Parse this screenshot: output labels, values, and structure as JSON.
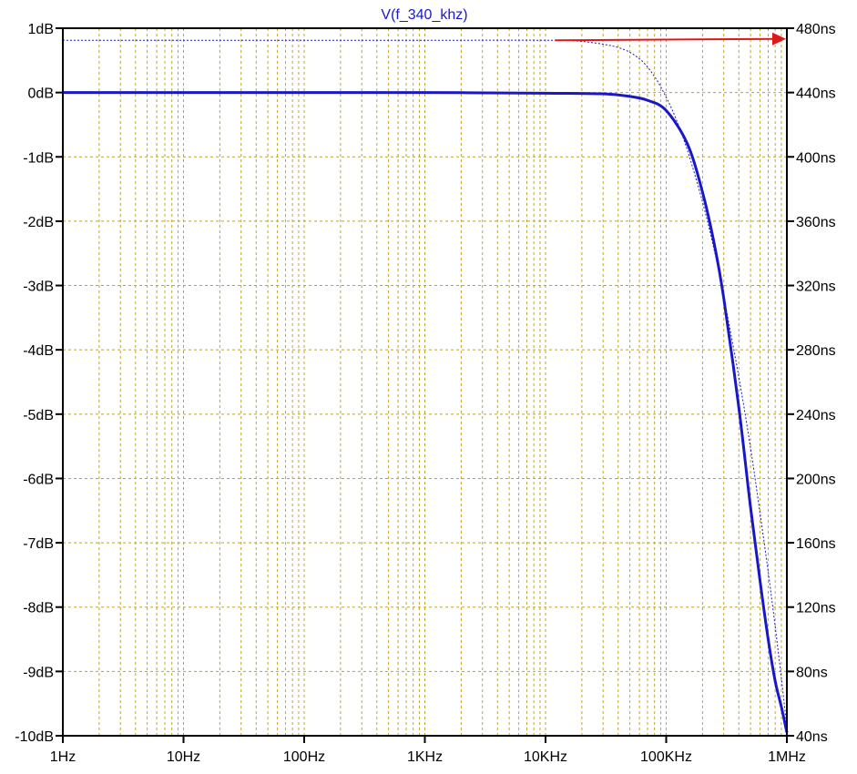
{
  "chart_data": {
    "type": "line",
    "title": "V(f_340_khz)",
    "x_scale": "log",
    "xlim": [
      1,
      1000000
    ],
    "x_ticks": [
      {
        "value": 1,
        "label": "1Hz"
      },
      {
        "value": 10,
        "label": "10Hz"
      },
      {
        "value": 100,
        "label": "100Hz"
      },
      {
        "value": 1000,
        "label": "1KHz"
      },
      {
        "value": 10000,
        "label": "10KHz"
      },
      {
        "value": 100000,
        "label": "100KHz"
      },
      {
        "value": 1000000,
        "label": "1MHz"
      }
    ],
    "y_left": {
      "unit": "dB",
      "ylim": [
        -10,
        1
      ],
      "ticks": [
        {
          "value": 1,
          "label": "1dB"
        },
        {
          "value": 0,
          "label": "0dB"
        },
        {
          "value": -1,
          "label": "-1dB"
        },
        {
          "value": -2,
          "label": "-2dB"
        },
        {
          "value": -3,
          "label": "-3dB"
        },
        {
          "value": -4,
          "label": "-4dB"
        },
        {
          "value": -5,
          "label": "-5dB"
        },
        {
          "value": -6,
          "label": "-6dB"
        },
        {
          "value": -7,
          "label": "-7dB"
        },
        {
          "value": -8,
          "label": "-8dB"
        },
        {
          "value": -9,
          "label": "-9dB"
        },
        {
          "value": -10,
          "label": "-10dB"
        }
      ]
    },
    "y_right": {
      "unit": "ns",
      "ylim": [
        40,
        480
      ],
      "ticks": [
        {
          "value": 480,
          "label": "480ns"
        },
        {
          "value": 440,
          "label": "440ns"
        },
        {
          "value": 400,
          "label": "400ns"
        },
        {
          "value": 360,
          "label": "360ns"
        },
        {
          "value": 320,
          "label": "320ns"
        },
        {
          "value": 280,
          "label": "280ns"
        },
        {
          "value": 240,
          "label": "240ns"
        },
        {
          "value": 200,
          "label": "200ns"
        },
        {
          "value": 160,
          "label": "160ns"
        },
        {
          "value": 120,
          "label": "120ns"
        },
        {
          "value": 80,
          "label": "80ns"
        },
        {
          "value": 40,
          "label": "40ns"
        }
      ]
    },
    "grid": true,
    "series": [
      {
        "axis": "left",
        "style": "solid",
        "color": "#1818c8",
        "x": [
          1,
          10,
          100,
          1000,
          10000,
          30000,
          50000,
          70000,
          100000,
          150000,
          200000,
          250000,
          300000,
          400000,
          500000,
          600000,
          700000,
          800000,
          900000,
          1000000
        ],
        "y": [
          0,
          0,
          0,
          0,
          -0.01,
          -0.02,
          -0.06,
          -0.12,
          -0.28,
          -0.8,
          -1.55,
          -2.35,
          -3.2,
          -4.9,
          -6.45,
          -7.6,
          -8.5,
          -9.15,
          -9.55,
          -9.95
        ]
      },
      {
        "axis": "right",
        "style": "dotted",
        "color": "#1818c8",
        "x": [
          1,
          10,
          100,
          1000,
          10000,
          20000,
          40000,
          60000,
          80000,
          100000,
          120000,
          150000,
          200000,
          250000,
          300000,
          400000,
          500000,
          600000,
          700000,
          800000,
          900000,
          1000000
        ],
        "y": [
          472.5,
          472.5,
          472.5,
          472.5,
          472.5,
          471.8,
          468,
          461,
          450,
          437,
          424,
          404,
          372,
          342,
          313,
          263,
          219,
          178,
          142,
          108,
          76,
          45
        ]
      }
    ],
    "axis_scale_arrow_color": "#e01818"
  },
  "colors": {
    "plot_background": "#ffffff",
    "grid": "#c8a800",
    "frame": "#000000",
    "title": "#1818c8"
  }
}
